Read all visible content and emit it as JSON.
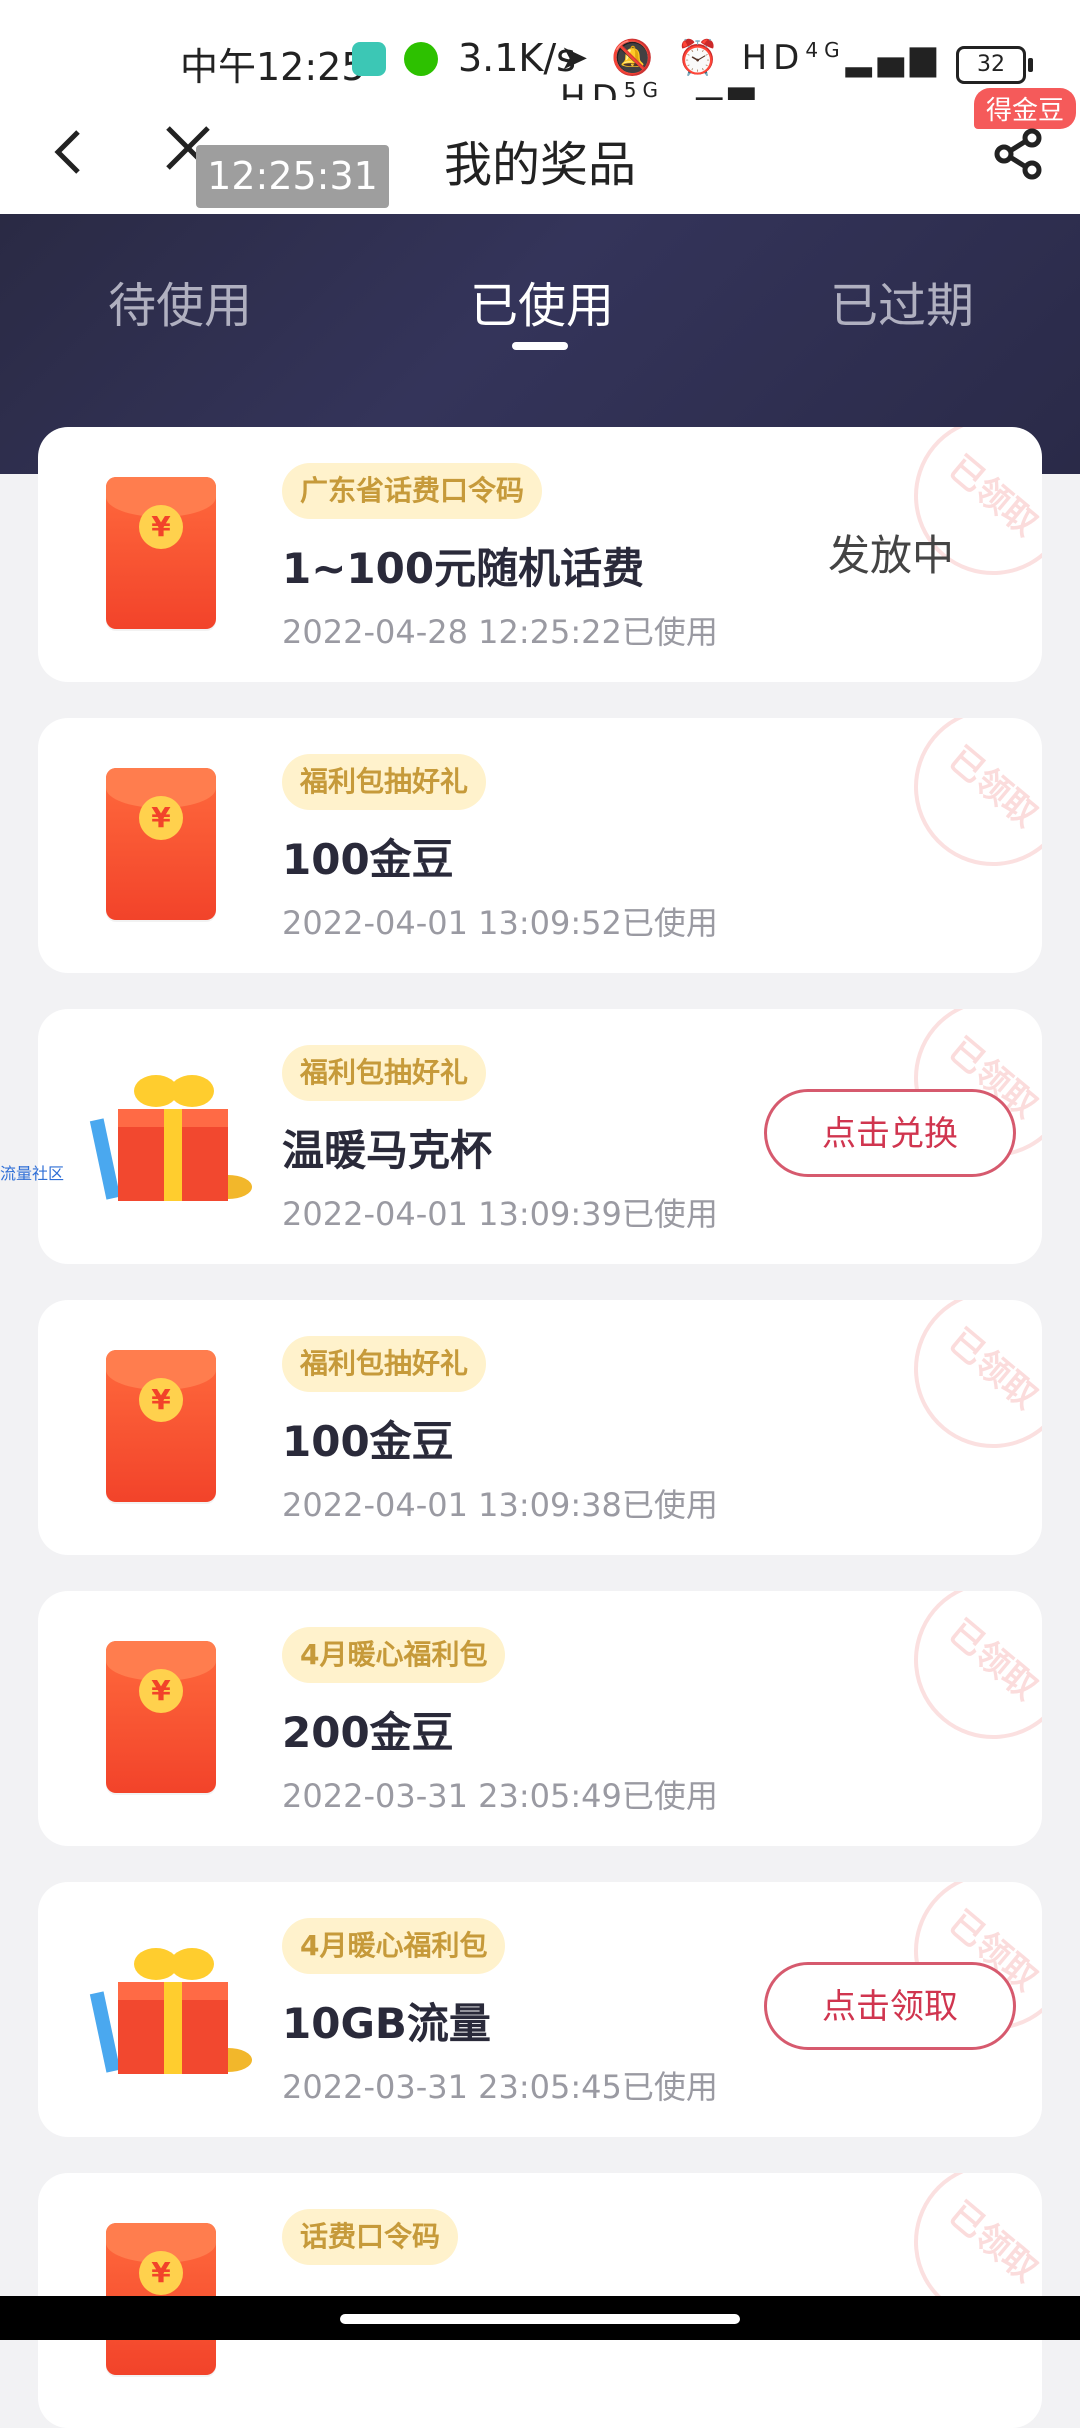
{
  "statusbar": {
    "time": "中午12:25",
    "net_speed": "3.1K/s",
    "signal_1": "4G",
    "signal_2": "5G",
    "battery": "32"
  },
  "nav": {
    "title": "我的奖品",
    "overlay_time": "12:25:31",
    "share_badge": "得金豆"
  },
  "tabs": [
    {
      "label": "待使用",
      "active": false
    },
    {
      "label": "已使用",
      "active": true
    },
    {
      "label": "已过期",
      "active": false
    }
  ],
  "stamp_text": "已领取",
  "items": [
    {
      "tag": "广东省话费口令码",
      "title": "1~100元随机话费",
      "date": "2022-04-28 12:25:22已使用",
      "status": "发放中",
      "thumb": "red-packet"
    },
    {
      "tag": "福利包抽好礼",
      "title": "100金豆",
      "date": "2022-04-01 13:09:52已使用",
      "thumb": "red-packet"
    },
    {
      "tag": "福利包抽好礼",
      "title": "温暖马克杯",
      "date": "2022-04-01 13:09:39已使用",
      "action": "点击兑换",
      "thumb": "gift-box"
    },
    {
      "tag": "福利包抽好礼",
      "title": "100金豆",
      "date": "2022-04-01 13:09:38已使用",
      "thumb": "red-packet"
    },
    {
      "tag": "4月暖心福利包",
      "title": "200金豆",
      "date": "2022-03-31 23:05:49已使用",
      "thumb": "red-packet"
    },
    {
      "tag": "4月暖心福利包",
      "title": "10GB流量",
      "date": "2022-03-31 23:05:45已使用",
      "action": "点击领取",
      "thumb": "gift-box"
    },
    {
      "tag": "话费口令码",
      "thumb": "red-packet"
    }
  ],
  "watermark": "流量社区",
  "colors": {
    "header_bg": "#2a2a44",
    "tag_bg": "#fff2cc",
    "tag_text": "#c69a3a",
    "button_border": "#d65a6e"
  }
}
